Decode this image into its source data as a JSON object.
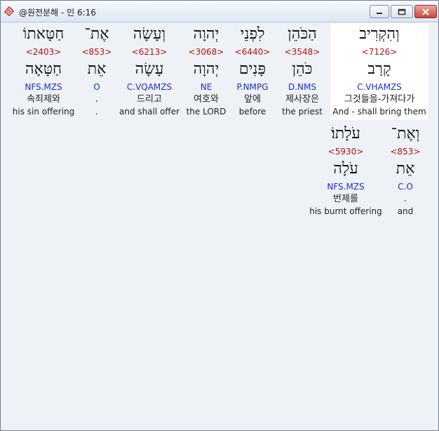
{
  "window": {
    "title": "@원전분해 - 민 6:16"
  },
  "words": [
    {
      "hebrew": "וְהִקְרִיב",
      "strong": "<7126>",
      "lemma": "קָרַב",
      "morph": "C.VHAMZS",
      "korean": "그것들을-가져다가",
      "english": "And - shall bring them",
      "highlight": true
    },
    {
      "hebrew": "הַכֹּהֵן",
      "strong": "<3548>",
      "lemma": "כֹּהֵן",
      "morph": "D.NMS",
      "korean": "제사장은",
      "english": "the priest",
      "highlight": false
    },
    {
      "hebrew": "לִפְנֵי",
      "strong": "<6440>",
      "lemma": "פָּנִים",
      "morph": "P.NMPG",
      "korean": "앞에",
      "english": "before",
      "highlight": false
    },
    {
      "hebrew": "יְהוָה",
      "strong": "<3068>",
      "lemma": "יְהוָה",
      "morph": "NE",
      "korean": "여호와",
      "english": "the LORD",
      "highlight": false
    },
    {
      "hebrew": "וְעָשָׂה",
      "strong": "<6213>",
      "lemma": "עָשָׂה",
      "morph": "C.VQAMZS",
      "korean": "드리고",
      "english": "and shall offer",
      "highlight": false
    },
    {
      "hebrew": "אֶת־",
      "strong": "<853>",
      "lemma": "אֵת",
      "morph": "O",
      "korean": ".",
      "english": ".",
      "highlight": false
    },
    {
      "hebrew": "חַטָּאתוֹ",
      "strong": "<2403>",
      "lemma": "חַטָּאָה",
      "morph": "NFS.MZS",
      "korean": "속죄제와",
      "english": "his sin offering",
      "highlight": false
    },
    {
      "hebrew": "וְאֶת־",
      "strong": "<853>",
      "lemma": "אֵת",
      "morph": "C.O",
      "korean": ".",
      "english": "and",
      "highlight": false
    },
    {
      "hebrew": "עֹלָתוֹ׃",
      "strong": "<5930>",
      "lemma": "עֹלָה",
      "morph": "NFS.MZS",
      "korean": "번제를",
      "english": "his burnt offering",
      "highlight": false
    }
  ]
}
